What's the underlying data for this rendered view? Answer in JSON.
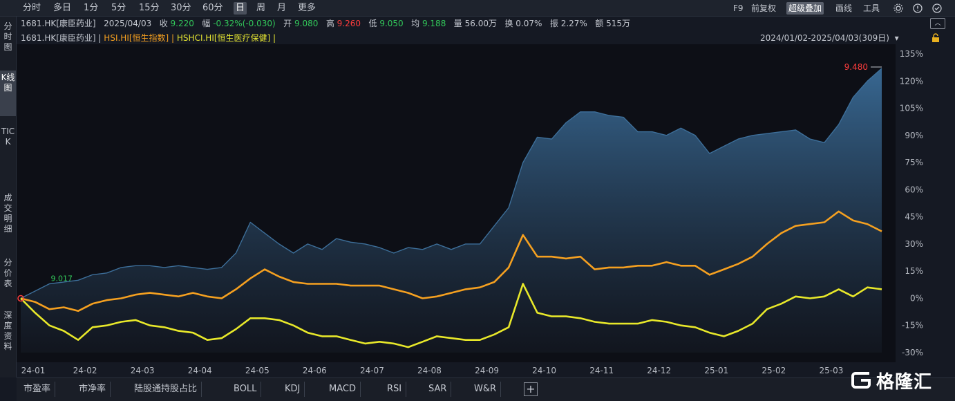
{
  "toolbar": {
    "periods": [
      "分时",
      "多日",
      "1分",
      "5分",
      "15分",
      "30分",
      "60分",
      "日",
      "周",
      "月",
      "更多"
    ],
    "active_period": "日",
    "tools": [
      "F9",
      "前复权",
      "超级叠加",
      "画线",
      "工具"
    ],
    "active_tool": "超级叠加",
    "icons": [
      "gear-icon",
      "alarm-icon",
      "settings-icon"
    ]
  },
  "side_nav": {
    "items": [
      "分时图",
      "K线图",
      "TICK",
      "成交明细",
      "分价表",
      "深度资料"
    ],
    "active_index": 1
  },
  "quote": {
    "code_name": "1681.HK[康臣药业]",
    "date": "2025/04/03",
    "close_label": "收",
    "close": "9.220",
    "change_label": "幅",
    "change": "-0.32%(-0.030)",
    "open_label": "开",
    "open": "9.080",
    "high_label": "高",
    "high": "9.260",
    "low_label": "低",
    "low": "9.050",
    "avg_label": "均",
    "avg": "9.188",
    "volume_label": "量",
    "volume": "56.00万",
    "turnover_label": "换",
    "turnover": "0.07%",
    "amplitude_label": "振",
    "amplitude": "2.27%",
    "amount_label": "额",
    "amount": "515万"
  },
  "overlay": {
    "main": "1681.HK[康臣药业] |",
    "hsi": "HSI.HI[恒生指数] |",
    "hshci": "HSHCI.HI[恒生医疗保健] |"
  },
  "range_label": "2024/01/02-2025/04/03(309日)",
  "colors": {
    "main_line": "#3d6f9a",
    "main_fill_top": "#3a6c98",
    "main_fill_bottom": "#151a24",
    "hsi": "#f5a020",
    "hshci": "#e8e82a",
    "up": "#32c85a",
    "down": "#ff3d3d"
  },
  "chart_data": {
    "type": "area",
    "x": [
      "24-01",
      "24-01",
      "24-01",
      "24-01",
      "24-02",
      "24-02",
      "24-02",
      "24-02",
      "24-03",
      "24-03",
      "24-03",
      "24-03",
      "24-04",
      "24-04",
      "24-04",
      "24-04",
      "24-05",
      "24-05",
      "24-05",
      "24-05",
      "24-06",
      "24-06",
      "24-06",
      "24-06",
      "24-07",
      "24-07",
      "24-07",
      "24-07",
      "24-08",
      "24-08",
      "24-08",
      "24-08",
      "24-09",
      "24-09",
      "24-09",
      "24-09",
      "24-10",
      "24-10",
      "24-10",
      "24-10",
      "24-11",
      "24-11",
      "24-11",
      "24-11",
      "24-12",
      "24-12",
      "24-12",
      "24-12",
      "25-01",
      "25-01",
      "25-01",
      "25-01",
      "25-02",
      "25-02",
      "25-02",
      "25-02",
      "25-03",
      "25-03",
      "25-03",
      "25-03",
      "25-04"
    ],
    "x_ticks": [
      "24-01",
      "24-02",
      "24-03",
      "24-04",
      "24-05",
      "24-06",
      "24-07",
      "24-08",
      "24-09",
      "24-10",
      "24-11",
      "24-12",
      "25-01",
      "25-02",
      "25-03"
    ],
    "y_ticks": [
      "135%",
      "120%",
      "105%",
      "90%",
      "75%",
      "60%",
      "45%",
      "30%",
      "15%",
      "0%",
      "-15%",
      "-30%"
    ],
    "ylim": [
      -30,
      135
    ],
    "series": [
      {
        "name": "1681.HK[康臣药业]",
        "values": [
          0,
          4,
          8,
          9,
          10,
          13,
          14,
          17,
          18,
          18,
          17,
          18,
          17,
          16,
          17,
          25,
          42,
          36,
          30,
          25,
          30,
          27,
          33,
          31,
          30,
          28,
          25,
          28,
          27,
          30,
          27,
          30,
          30,
          40,
          50,
          75,
          89,
          88,
          97,
          103,
          103,
          101,
          100,
          92,
          92,
          90,
          94,
          90,
          80,
          84,
          88,
          90,
          91,
          92,
          93,
          88,
          86,
          96,
          111,
          120,
          127
        ]
      },
      {
        "name": "HSI.HI[恒生指数]",
        "values": [
          0,
          -2,
          -6,
          -5,
          -7,
          -3,
          -1,
          0,
          2,
          3,
          2,
          1,
          3,
          1,
          0,
          5,
          11,
          16,
          12,
          9,
          8,
          8,
          8,
          7,
          7,
          7,
          5,
          3,
          0,
          1,
          3,
          5,
          6,
          9,
          17,
          35,
          23,
          23,
          22,
          23,
          16,
          17,
          17,
          18,
          18,
          20,
          18,
          18,
          13,
          16,
          19,
          23,
          30,
          36,
          40,
          41,
          42,
          48,
          43,
          41,
          37
        ]
      },
      {
        "name": "HSHCI.HI[恒生医疗保健]",
        "values": [
          0,
          -8,
          -15,
          -18,
          -23,
          -16,
          -15,
          -13,
          -12,
          -15,
          -16,
          -18,
          -19,
          -23,
          -22,
          -17,
          -11,
          -11,
          -12,
          -15,
          -19,
          -21,
          -21,
          -23,
          -25,
          -24,
          -25,
          -27,
          -24,
          -21,
          -22,
          -23,
          -23,
          -20,
          -16,
          8,
          -8,
          -10,
          -10,
          -11,
          -13,
          -14,
          -14,
          -14,
          -12,
          -13,
          -15,
          -16,
          -19,
          -21,
          -18,
          -14,
          -6,
          -3,
          1,
          0,
          1,
          5,
          1,
          6,
          5
        ]
      }
    ],
    "annotations": [
      {
        "label": "9.480",
        "series": 0,
        "index": 60
      },
      {
        "label": "9.017",
        "series": 0,
        "index": 2
      }
    ]
  },
  "bottom_tabs": [
    "市盈率",
    "市净率",
    "陆股通持股占比",
    "BOLL",
    "KDJ",
    "MACD",
    "RSI",
    "SAR",
    "W&R"
  ],
  "watermark": {
    "text": "格隆汇"
  }
}
